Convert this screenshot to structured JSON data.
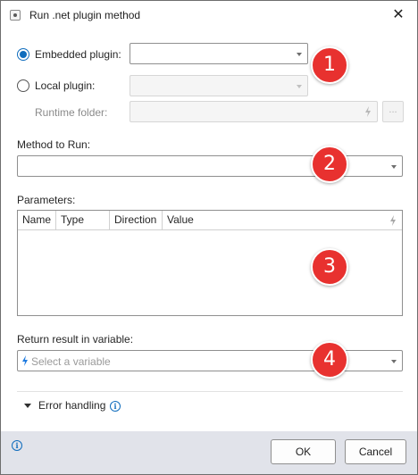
{
  "window": {
    "title": "Run .net plugin method",
    "close_glyph": "✕",
    "app_icon": "plugin-icon"
  },
  "plugin_source": {
    "embedded_label": "Embedded plugin:",
    "embedded_selected": true,
    "embedded_value": "",
    "local_label": "Local plugin:",
    "local_selected": false,
    "local_value": "",
    "runtime_folder_label": "Runtime folder:",
    "runtime_folder_value": "",
    "browse_label": "..."
  },
  "method": {
    "label": "Method to Run:",
    "value": ""
  },
  "parameters": {
    "label": "Parameters:",
    "columns": [
      "Name",
      "Type",
      "Direction",
      "Value"
    ],
    "rows": []
  },
  "return_result": {
    "label": "Return result in variable:",
    "placeholder": "Select a variable"
  },
  "error_handling": {
    "label": "Error handling"
  },
  "footer": {
    "ok_label": "OK",
    "cancel_label": "Cancel"
  },
  "callouts": [
    "1",
    "2",
    "3",
    "4"
  ],
  "colors": {
    "accent": "#0f6cbd",
    "callout": "#e8312f",
    "footer_bg": "#e1e3ea",
    "variable_bolt": "#1e7be0"
  }
}
